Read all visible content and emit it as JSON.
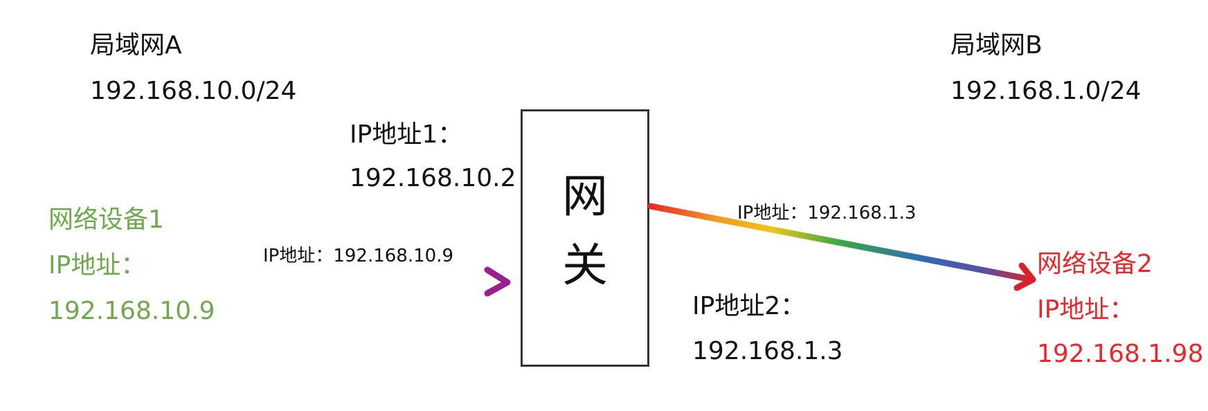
{
  "lan_a": {
    "title": "局域网A",
    "subnet": "192.168.10.0/24"
  },
  "lan_b": {
    "title": "局域网B",
    "subnet": "192.168.1.0/24"
  },
  "gateway": {
    "char_1": "网",
    "char_2": "关",
    "ip1_label": "IP地址1：",
    "ip1_value": "192.168.10.2",
    "ip2_label": "IP地址2：",
    "ip2_value": "192.168.1.3"
  },
  "device_1": {
    "name": "网络设备1",
    "ip_label": "IP地址：",
    "ip_value": "192.168.10.9",
    "color": "#6fa84f"
  },
  "device_2": {
    "name": "网络设备2",
    "ip_label": "IP地址：",
    "ip_value": "192.168.1.98",
    "color": "#e8262b"
  },
  "arrows": {
    "to_gateway_label": "IP地址：192.168.10.9",
    "to_device2_label": "IP地址：192.168.1.3"
  }
}
